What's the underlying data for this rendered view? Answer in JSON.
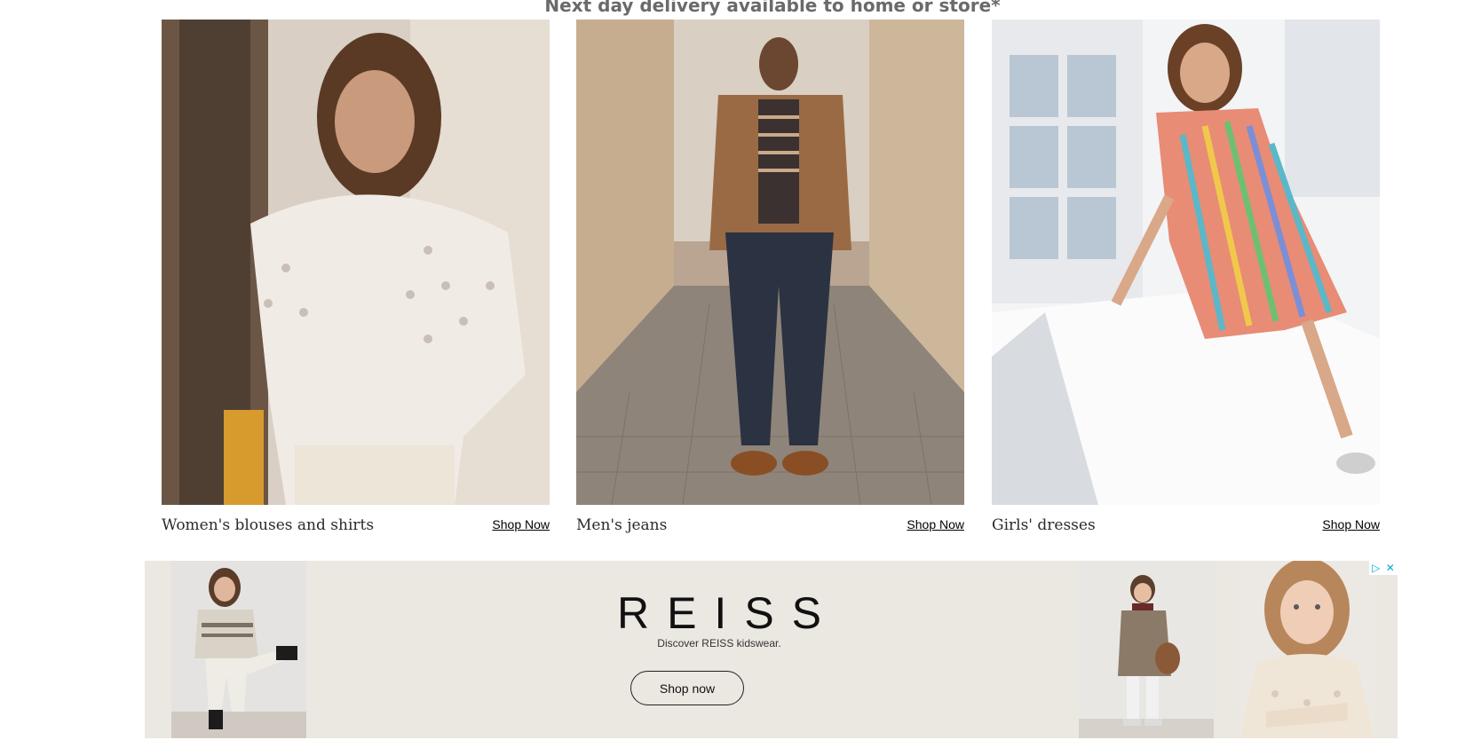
{
  "banner": {
    "text": "Next day delivery available to home or store*"
  },
  "cards": [
    {
      "caption": "Women's blouses and shirts",
      "link": "Shop Now"
    },
    {
      "caption": "Men's jeans",
      "link": "Shop Now"
    },
    {
      "caption": "Girls' dresses",
      "link": "Shop Now"
    }
  ],
  "ad": {
    "brand": "REISS",
    "tagline": "Discover REISS kidswear.",
    "button": "Shop now",
    "play_glyph": "▷",
    "close_glyph": "✕"
  }
}
